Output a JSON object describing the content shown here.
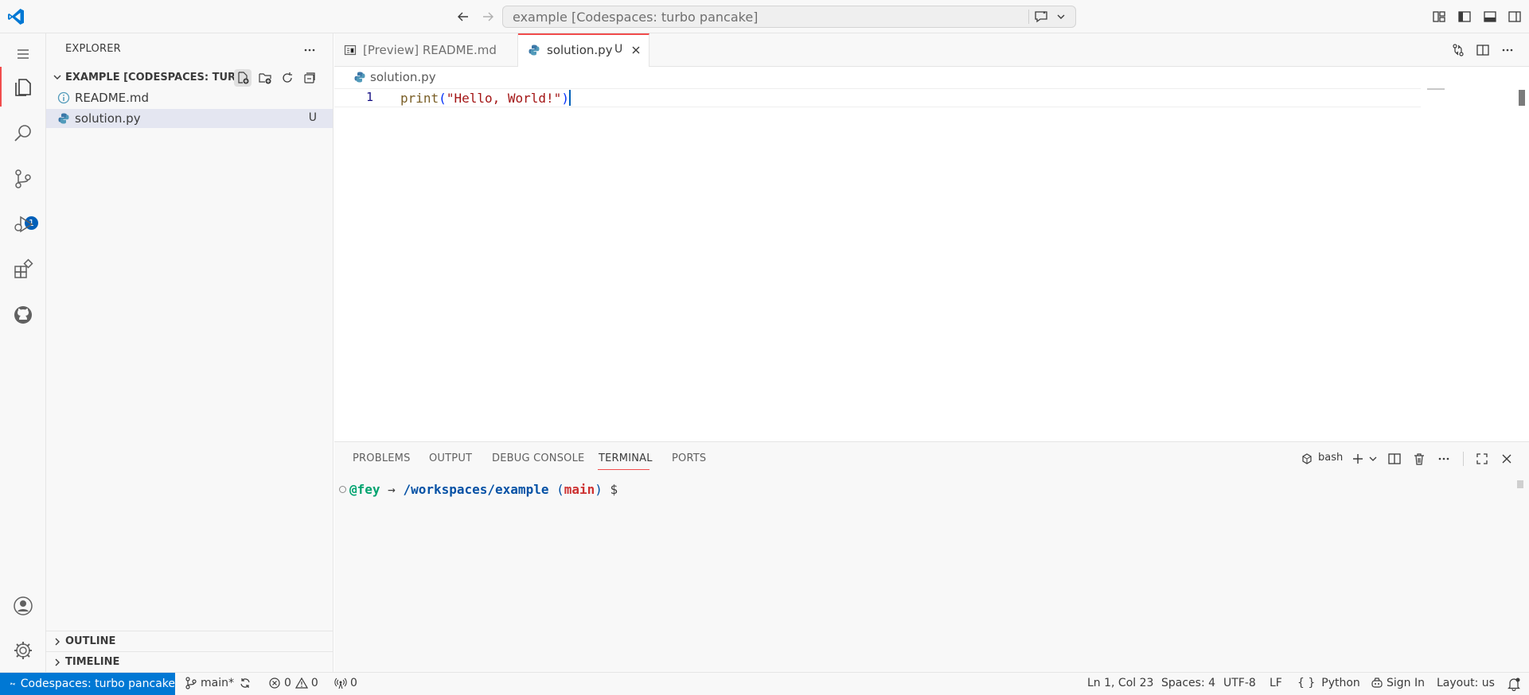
{
  "titlebar": {
    "command_center": "example [Codespaces: turbo pancake]"
  },
  "activity_bar": {
    "scm_badge": "1"
  },
  "sidebar": {
    "title": "EXPLORER",
    "folder_name": "EXAMPLE [CODESPACES: TURB...",
    "files": [
      {
        "name": "README.md",
        "badge": ""
      },
      {
        "name": "solution.py",
        "badge": "U"
      }
    ],
    "outline_label": "OUTLINE",
    "timeline_label": "TIMELINE"
  },
  "tabs": [
    {
      "label": "[Preview] README.md"
    },
    {
      "label": "solution.py",
      "badge": "U"
    }
  ],
  "breadcrumb": "solution.py",
  "editor": {
    "line_number": "1",
    "code": {
      "fn": "print",
      "open": "(",
      "string": "\"Hello, World!\"",
      "close": ")"
    }
  },
  "panel": {
    "tabs": [
      "PROBLEMS",
      "OUTPUT",
      "DEBUG CONSOLE",
      "TERMINAL",
      "PORTS"
    ],
    "shell": "bash",
    "terminal": {
      "user": "@fey",
      "arrow": " → ",
      "path": "/workspaces/example",
      "branch_open": " (",
      "branch": "main",
      "branch_close": ")",
      "prompt": " $"
    }
  },
  "statusbar": {
    "remote": "Codespaces: turbo pancake",
    "branch": "main*",
    "errors": "0",
    "warnings": "0",
    "ports": "0",
    "cursor_position": "Ln 1, Col 23",
    "indentation": "Spaces: 4",
    "encoding": "UTF-8",
    "eol": "LF",
    "language": "Python",
    "sign_in": "Sign In",
    "keyboard_layout": "Layout: us"
  },
  "colors": {
    "accent": "#0078d4",
    "active_tab_border": "#f14c4c",
    "badge": "#005fb8"
  }
}
